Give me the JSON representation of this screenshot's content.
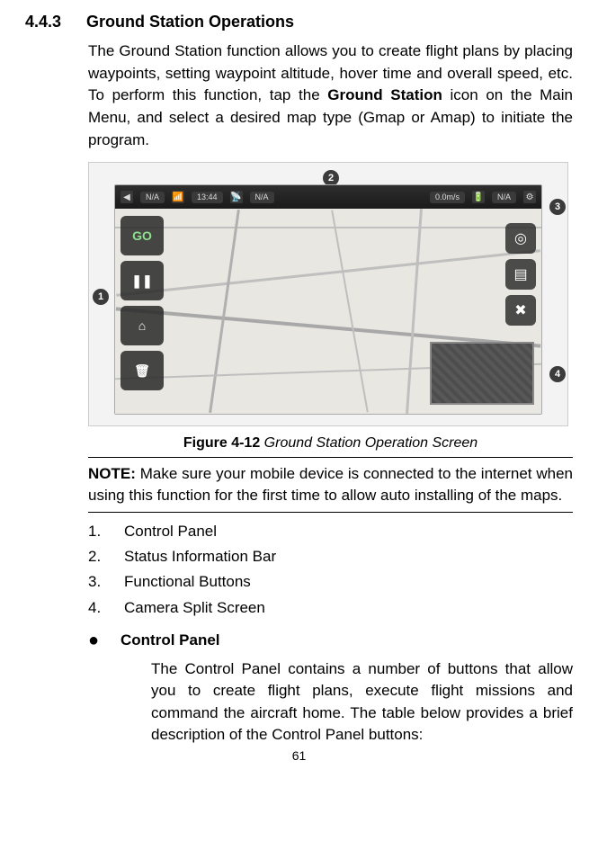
{
  "section": {
    "number": "4.4.3",
    "title": "Ground Station Operations"
  },
  "intro": {
    "p1a": "The Ground Station function allows you to create flight plans by placing waypoints, setting waypoint altitude, hover time and overall speed, etc. To perform this function, tap the ",
    "p1b": "Ground Station",
    "p1c": " icon on the Main Menu, and select a desired map type (Gmap or Amap) to initiate the program."
  },
  "figure": {
    "label_bold": "Figure 4-12",
    "label_italic": " Ground Station Operation Screen",
    "callouts": {
      "c1": "1",
      "c2": "2",
      "c3": "3",
      "c4": "4"
    },
    "statusbar": {
      "mode": "N/A",
      "sat": "13:44",
      "rc": "N/A",
      "speed": "0.0m/s",
      "batt": "N/A"
    },
    "control_panel": {
      "go": "GO",
      "pause": "❚❚",
      "home": "⌂",
      "delete": "🗑"
    },
    "right_buttons": {
      "locate": "◎",
      "layers": "▤",
      "clear": "✖"
    }
  },
  "note": {
    "strong": "NOTE:",
    "text": " Make sure your mobile device is connected to the internet when using this function for the first time to allow auto installing of the maps."
  },
  "list": {
    "i1": "Control Panel",
    "i2": "Status Information Bar",
    "i3": "Functional Buttons",
    "i4": "Camera Split Screen"
  },
  "bullet": {
    "title": "Control Panel"
  },
  "control_panel_desc": "The Control Panel contains a number of buttons that allow you to create flight plans, execute flight missions and command the aircraft home. The table below provides a brief description of the Control Panel buttons:",
  "page_number": "61"
}
